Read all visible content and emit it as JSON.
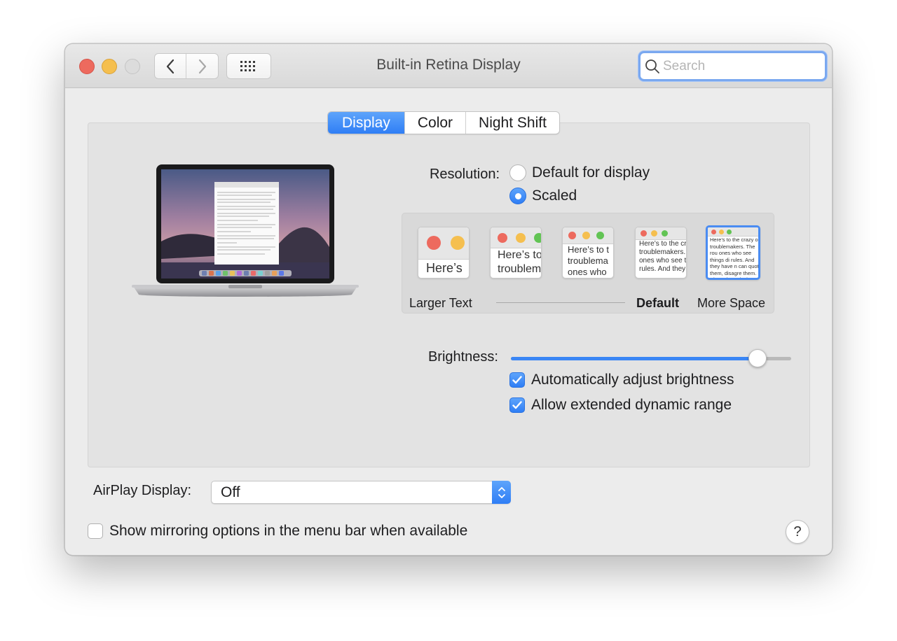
{
  "window": {
    "title": "Built-in Retina Display"
  },
  "toolbar": {
    "back_icon": "chevron-left-icon",
    "forward_icon": "chevron-right-icon",
    "show_all_icon": "grid-icon"
  },
  "search": {
    "placeholder": "Search",
    "value": ""
  },
  "tabs": [
    {
      "label": "Display",
      "active": true
    },
    {
      "label": "Color",
      "active": false
    },
    {
      "label": "Night Shift",
      "active": false
    }
  ],
  "resolution": {
    "label": "Resolution:",
    "options": [
      {
        "label": "Default for display",
        "selected": false
      },
      {
        "label": "Scaled",
        "selected": true
      }
    ],
    "scales": [
      {
        "preview_text": "Here’s"
      },
      {
        "preview_text": "Here’s to troublem"
      },
      {
        "preview_text": "Here’s to t troublema ones who"
      },
      {
        "preview_text": "Here’s to the cr troublemakers. ones who see t rules. And they"
      },
      {
        "preview_text": "Here’s to the crazy one troublemakers. The rou ones who see things di rules. And they have n can quote them, disagre them. About the only th Because they change t"
      }
    ],
    "selected_scale": 4,
    "larger_label": "Larger Text",
    "default_label": "Default",
    "more_label": "More Space"
  },
  "brightness": {
    "label": "Brightness:",
    "level": 0.88
  },
  "checkboxes": {
    "auto_brightness": {
      "label": "Automatically adjust brightness",
      "checked": true
    },
    "extended_range": {
      "label": "Allow extended dynamic range",
      "checked": true
    }
  },
  "airplay": {
    "label": "AirPlay Display:",
    "value": "Off"
  },
  "mirroring": {
    "label": "Show mirroring options in the menu bar when available",
    "checked": false
  },
  "help": {
    "label": "?"
  },
  "colors": {
    "accent": "#3a86f5",
    "close": "#ed6a5e",
    "minimize": "#f5bf4f",
    "pane": "#e3e3e3"
  }
}
